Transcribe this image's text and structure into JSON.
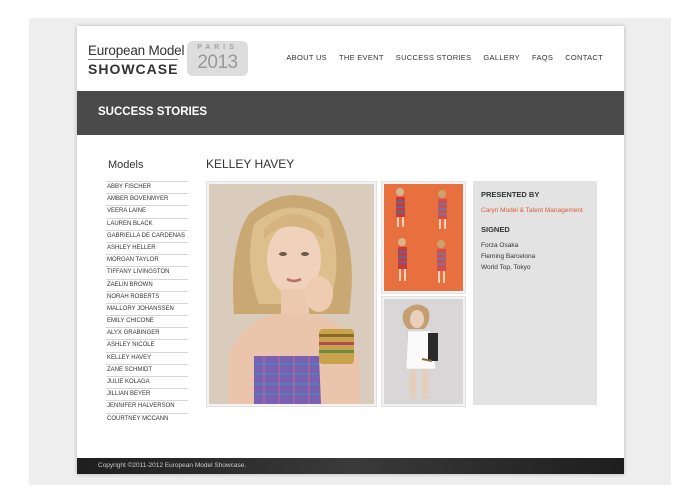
{
  "logo": {
    "line1": "European Model",
    "line2": "SHOWCASE",
    "badge_city": "PARIS",
    "badge_year": "2013"
  },
  "nav": {
    "items": [
      {
        "label": "ABOUT US"
      },
      {
        "label": "THE EVENT"
      },
      {
        "label": "SUCCESS STORIES"
      },
      {
        "label": "GALLERY"
      },
      {
        "label": "FAQS"
      },
      {
        "label": "CONTACT"
      }
    ]
  },
  "banner": {
    "title": "SUCCESS STORIES"
  },
  "sidebar": {
    "title": "Models",
    "models": [
      "ABBY FISCHER",
      "AMBER BOVENMYER",
      "VEERA LAINE",
      "LAUREN BLACK",
      "GABRIELLA DE CARDENAS",
      "ASHLEY HELLER",
      "MORGAN TAYLOR",
      "TIFFANY LIVINGSTON",
      "ZAELIN BROWN",
      "NORAH ROBERTS",
      "MALLORY JOHANSSEN",
      "EMILY CHICONE",
      "ALYX GRABINGER",
      "ASHLEY NICOLE",
      "KELLEY HAVEY",
      "ZANE SCHMIDT",
      "JULIE KOLAGA",
      "JILLIAN BEYER",
      "JENNIFER HALVERSON",
      "COURTNEY MCCANN"
    ]
  },
  "main": {
    "model_name": "KELLEY HAVEY"
  },
  "info": {
    "presented_heading": "PRESENTED BY",
    "presented_link": "Caryn Model & Talent Management",
    "signed_heading": "SIGNED",
    "signed_agencies": [
      "Forza Osaka",
      "Fleming Barcelona",
      "World Top, Tokyo"
    ]
  },
  "footer": {
    "copyright": "Copyright ©2011-2012 European Model Showcase."
  },
  "colors": {
    "banner": "#4a4a4a",
    "accent_link": "#e05a2a",
    "info_bg": "#e3e3e3",
    "footer": "#2a2a2a"
  }
}
